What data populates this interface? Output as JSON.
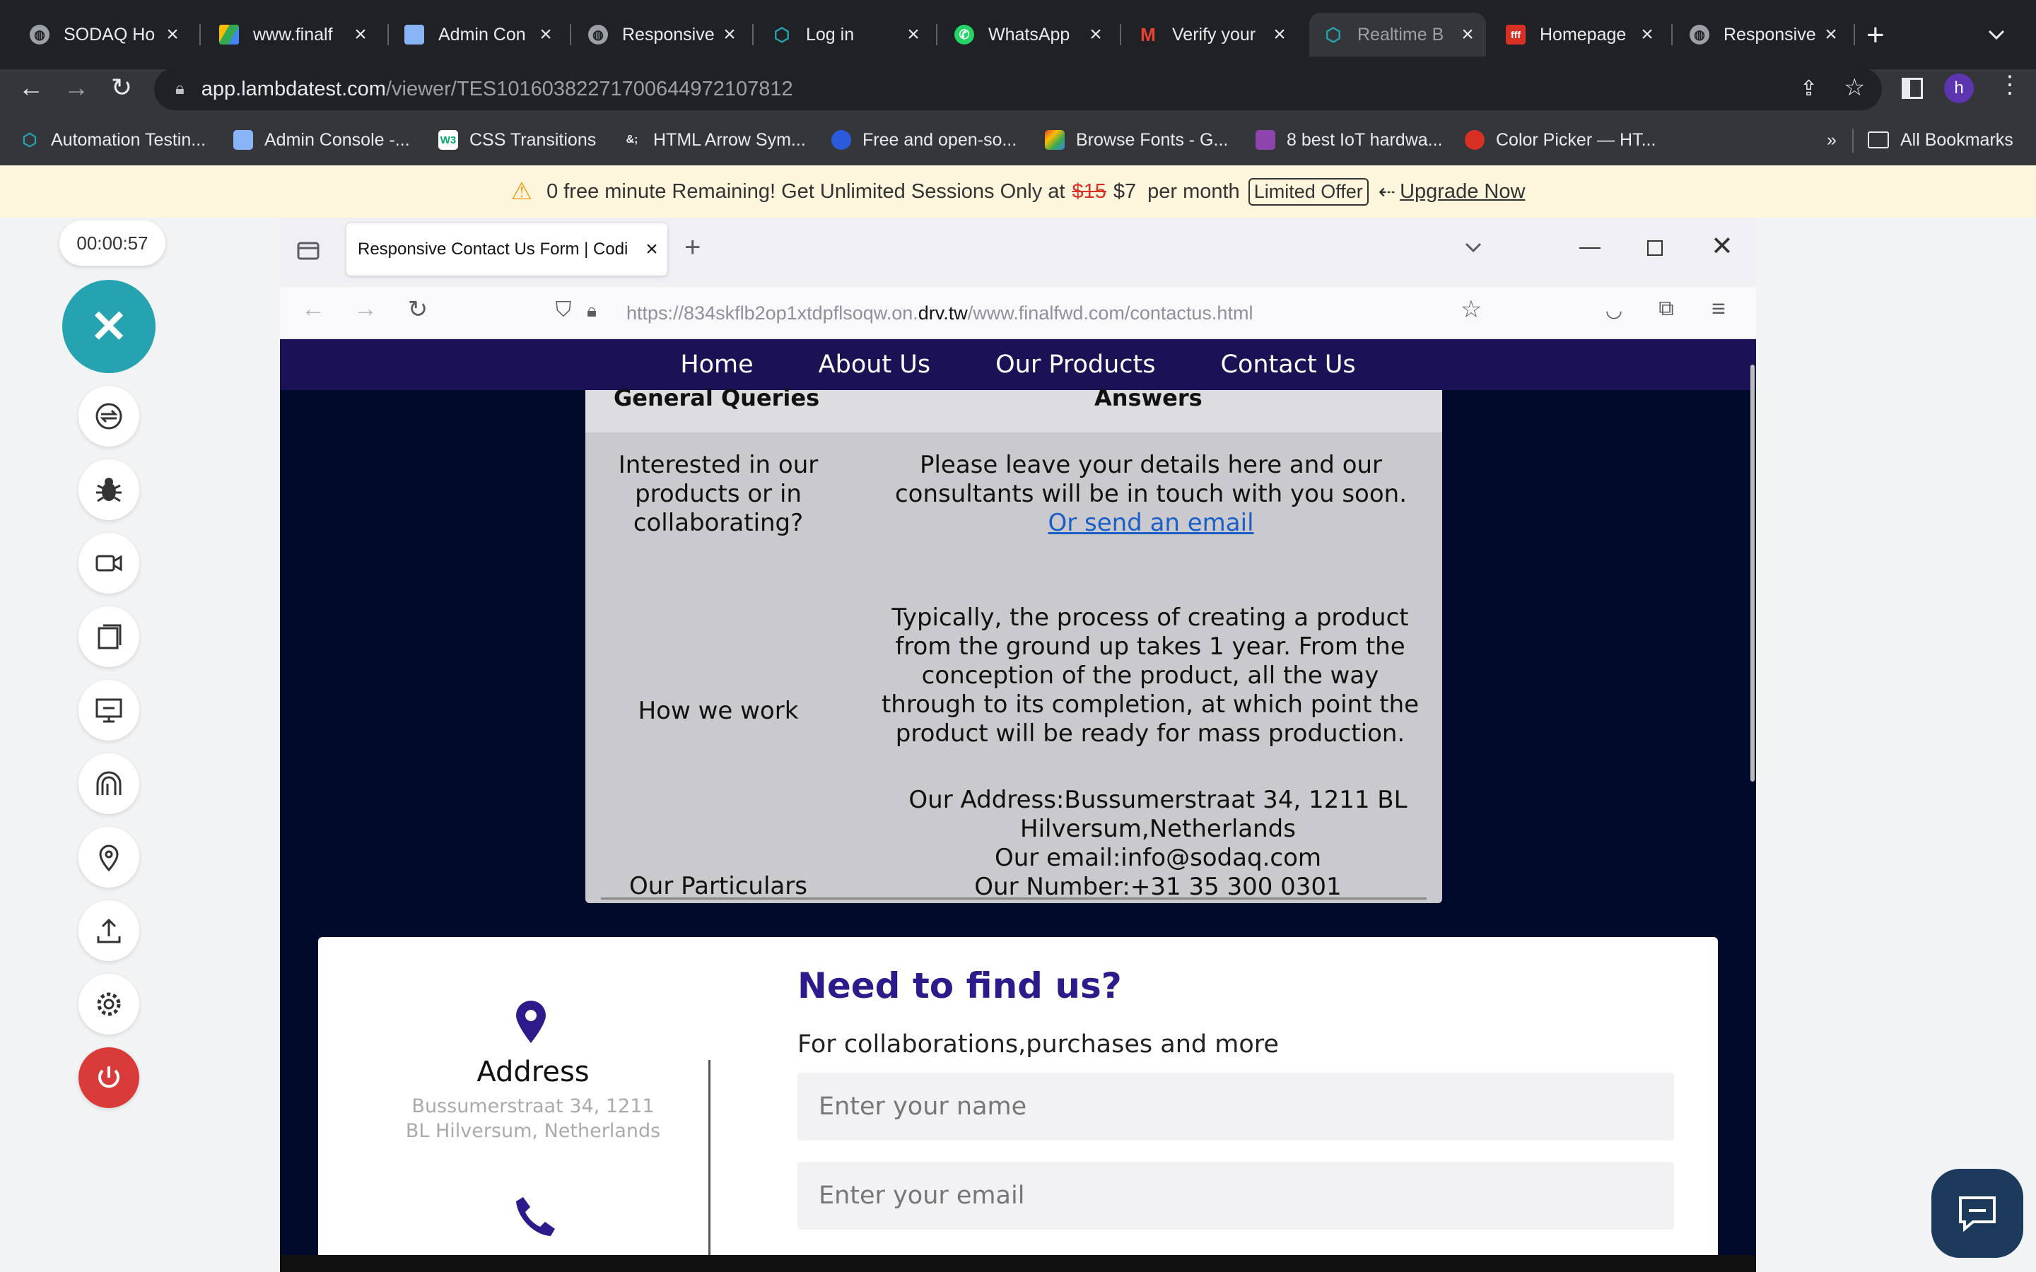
{
  "browser": {
    "tabs": [
      {
        "title": "SODAQ Ho",
        "icon": "globe-icon"
      },
      {
        "title": "www.finalf",
        "icon": "drive-icon"
      },
      {
        "title": "Admin Con",
        "icon": "admin-icon"
      },
      {
        "title": "Responsive",
        "icon": "globe-icon"
      },
      {
        "title": "Log in",
        "icon": "lambdatest-icon"
      },
      {
        "title": "WhatsApp",
        "icon": "whatsapp-icon"
      },
      {
        "title": "Verify your",
        "icon": "gmail-icon"
      },
      {
        "title": "Realtime B",
        "icon": "lambdatest-icon"
      },
      {
        "title": "Homepage",
        "icon": "fff-icon"
      },
      {
        "title": "Responsive",
        "icon": "globe-icon"
      }
    ],
    "url_host": "app.lambdatest.com",
    "url_path": "/viewer/TES10160382271700644972107812",
    "profile_initial": "h",
    "bookmarks": [
      {
        "label": "Automation Testin...",
        "icon": "lambdatest-icon"
      },
      {
        "label": "Admin Console -...",
        "icon": "admin-icon"
      },
      {
        "label": "CSS Transitions",
        "icon": "w3-icon"
      },
      {
        "label": "HTML Arrow Sym...",
        "icon": "amp-icon"
      },
      {
        "label": "Free and open-so...",
        "icon": "firefox-icon"
      },
      {
        "label": "Browse Fonts - G...",
        "icon": "fonts-icon"
      },
      {
        "label": "8 best IoT hardwa...",
        "icon": "iot-icon"
      },
      {
        "label": "Color Picker — HT...",
        "icon": "picker-icon"
      }
    ],
    "all_bookmarks": "All Bookmarks",
    "more_bookmarks": "»"
  },
  "banner": {
    "text": "0 free minute Remaining! Get Unlimited Sessions Only at",
    "old_price": "$15",
    "new_price": "$7",
    "per": "per month",
    "offer": "Limited Offer",
    "upgrade": "Upgrade Now",
    "upgrade_arrow": "⇠"
  },
  "sidebar": {
    "timer": "00:00:57",
    "close": "✕"
  },
  "remote": {
    "tab_title": "Responsive Contact Us Form | Codi",
    "url_prefix": "https://834skflb2op1xtdpflsoqw.on.",
    "url_domain": "drv.tw",
    "url_suffix": "/www.finalfwd.com/contactus.html"
  },
  "site": {
    "nav": [
      "Home",
      "About Us",
      "Our Products",
      "Contact Us"
    ],
    "faq": {
      "headers": [
        "General Queries",
        "Answers"
      ],
      "rows": [
        {
          "q": "Interested in our products or in collaborating?",
          "a": "Please leave your details here and our consultants will be in touch with you soon.",
          "link": "Or send an email"
        },
        {
          "q": "How we work",
          "a": "Typically, the process of creating a product from the ground up takes 1 year. From the conception of the product, all the way through to its completion, at which point the product will be ready for mass production."
        },
        {
          "q": "Our Particulars",
          "a_lines": [
            "Our Address:Bussumerstraat 34, 1211 BL Hilversum,Netherlands",
            "Our email:info@sodaq.com",
            "Our Number:+31 35 300 0301"
          ]
        }
      ]
    },
    "contact": {
      "address_title": "Address",
      "address_text": "Bussumerstraat 34, 1211 BL Hilversum, Netherlands",
      "heading": "Need to find us?",
      "subheading": "For collaborations,purchases and more",
      "name_placeholder": "Enter your name",
      "email_placeholder": "Enter your email"
    }
  },
  "colors": {
    "accent": "#26a3b0",
    "nav_bg": "#1a1254",
    "heading": "#2e1a8a",
    "power": "#d93a3a"
  }
}
